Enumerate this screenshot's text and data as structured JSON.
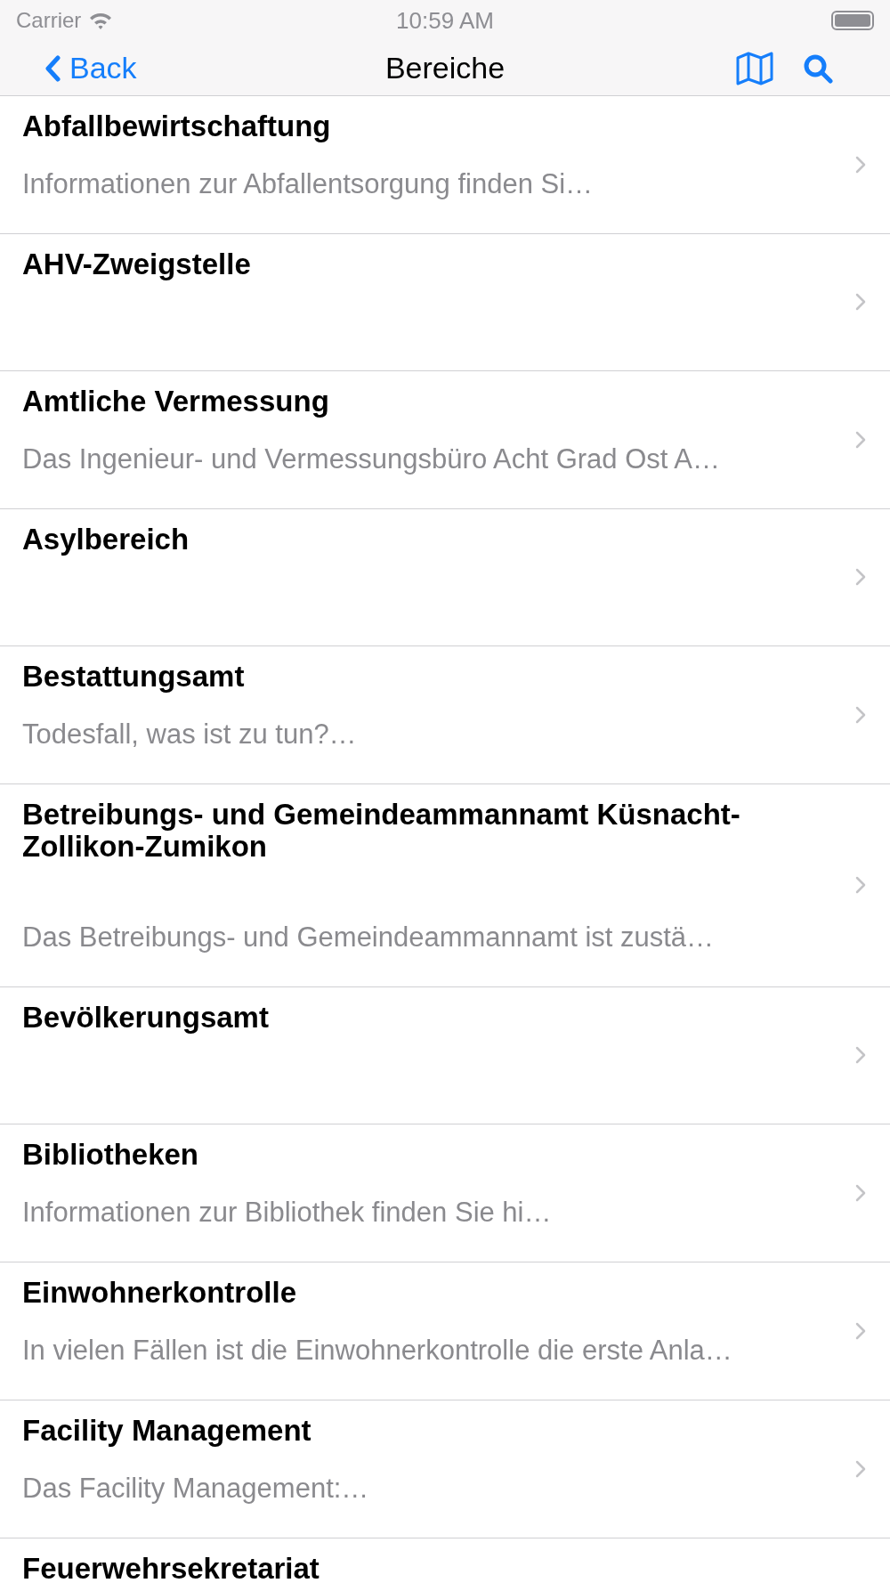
{
  "status_bar": {
    "carrier": "Carrier",
    "time": "10:59 AM"
  },
  "nav_bar": {
    "back": "Back",
    "title": "Bereiche"
  },
  "rows": [
    {
      "title": "Abfallbewirtschaftung",
      "subtitle": "Informationen zur Abfallentsorgung finden Si…",
      "chevron": true
    },
    {
      "title": "AHV-Zweigstelle",
      "chevron": true
    },
    {
      "title": "Amtliche Vermessung",
      "subtitle": "Das Ingenieur- und Vermessungsbüro Acht Grad Ost A…",
      "chevron": true
    },
    {
      "title": "Asylbereich",
      "chevron": true
    },
    {
      "title": "Bestattungsamt",
      "subtitle": "Todesfall, was ist zu tun?…",
      "chevron": true
    },
    {
      "title": "Betreibungs- und Gemeindeammannamt Küsnacht-Zollikon-Zumikon",
      "subtitle": "Das Betreibungs- und Gemeindeammannamt ist zustä…",
      "chevron": true
    },
    {
      "title": "Bevölkerungsamt",
      "chevron": true
    },
    {
      "title": "Bibliotheken",
      "subtitle": "Informationen zur Bibliothek finden Sie hi…",
      "chevron": true
    },
    {
      "title": "Einwohnerkontrolle",
      "subtitle": "In vielen Fällen ist die Einwohnerkontrolle die erste Anla…",
      "chevron": true
    },
    {
      "title": "Facility Management",
      "subtitle": "Das Facility Management:…",
      "chevron": true
    },
    {
      "title": "Feuerwehrsekretariat",
      "chevron": false
    }
  ]
}
